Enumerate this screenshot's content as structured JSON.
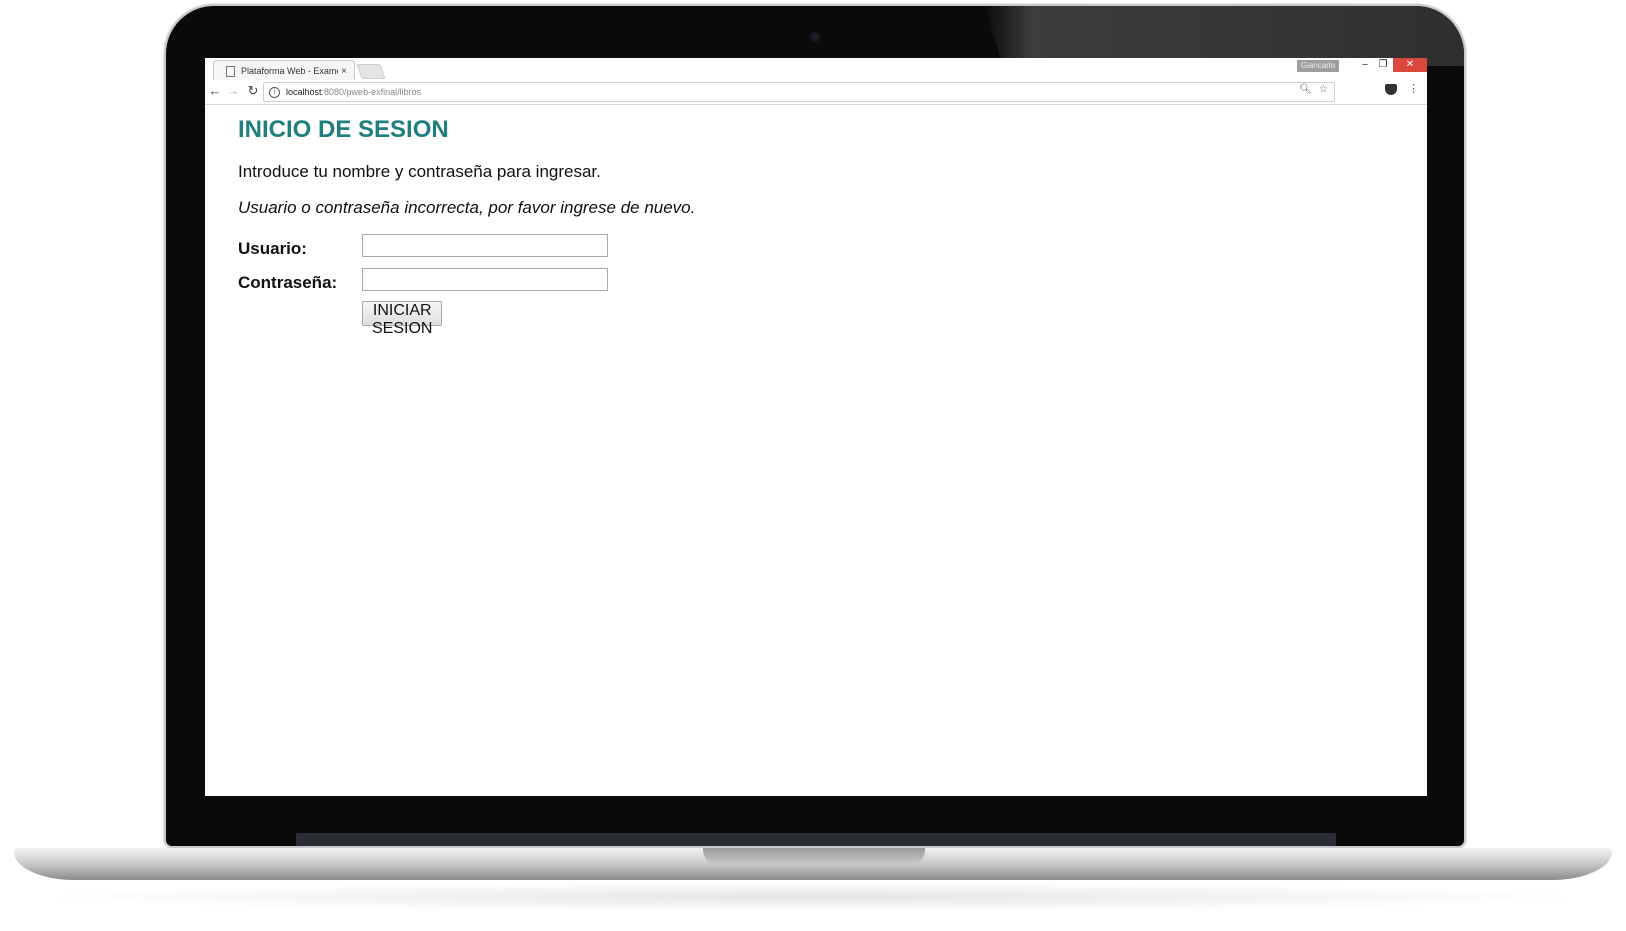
{
  "browser": {
    "tab_title": "Plataforma Web - Examen",
    "tab_close": "×",
    "user_badge": "Giancarlo",
    "window_controls": {
      "minimize": "–",
      "maximize": "❐",
      "close": "✕"
    },
    "nav": {
      "back": "←",
      "forward": "→",
      "reload": "↻"
    },
    "url_host": "localhost",
    "url_path": ":8080/pweb-exfinal/libros",
    "icons": [
      "info-icon",
      "zoom-icon",
      "star-icon",
      "pocket-icon",
      "menu-icon"
    ]
  },
  "page": {
    "title": "INICIO DE SESION",
    "intro": "Introduce tu nombre y contraseña para ingresar.",
    "error": "Usuario o contraseña incorrecta, por favor ingrese de nuevo.",
    "form": {
      "user_label": "Usuario:",
      "user_value": "",
      "pass_label": "Contraseña:",
      "pass_value": "",
      "submit_label": "INICIAR SESION"
    }
  },
  "colors": {
    "title": "#1f7e7e",
    "close_button": "#d9473d"
  }
}
